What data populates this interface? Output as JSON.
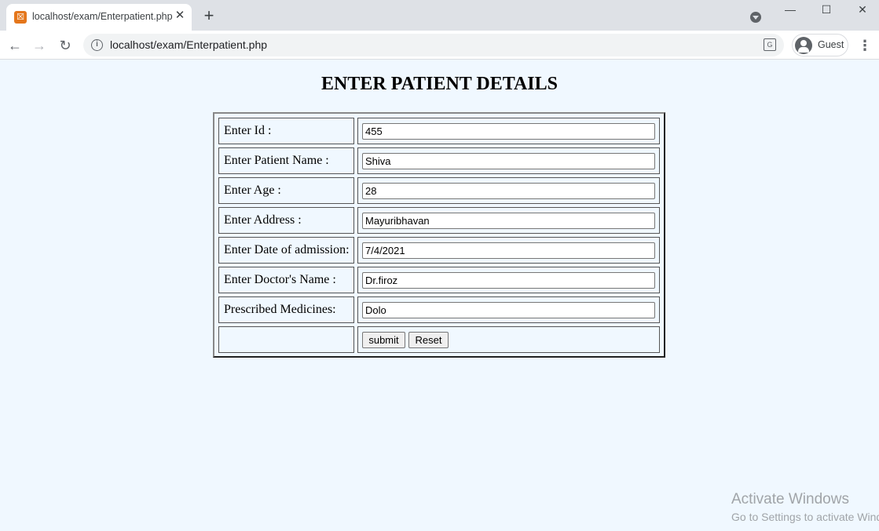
{
  "browser": {
    "tab_title": "localhost/exam/Enterpatient.php",
    "favicon_glyph": "☒",
    "new_tab": "+",
    "url": "localhost/exam/Enterpatient.php",
    "profile_label": "Guest",
    "window_controls": {
      "minimize": "—",
      "maximize": "☐",
      "close": "✕"
    }
  },
  "page": {
    "title": "ENTER PATIENT DETAILS",
    "rows": [
      {
        "label": "Enter Id :",
        "value": "455"
      },
      {
        "label": "Enter Patient Name :",
        "value": "Shiva"
      },
      {
        "label": "Enter Age :",
        "value": "28"
      },
      {
        "label": "Enter Address :",
        "value": "Mayuribhavan"
      },
      {
        "label": "Enter Date of admission:",
        "value": "7/4/2021"
      },
      {
        "label": "Enter Doctor's Name :",
        "value": "Dr.firoz"
      },
      {
        "label": "Prescribed Medicines:",
        "value": "Dolo"
      }
    ],
    "submit_label": "submit",
    "reset_label": "Reset"
  },
  "watermark": {
    "line1": "Activate Windows",
    "line2": "Go to Settings to activate Windows."
  }
}
